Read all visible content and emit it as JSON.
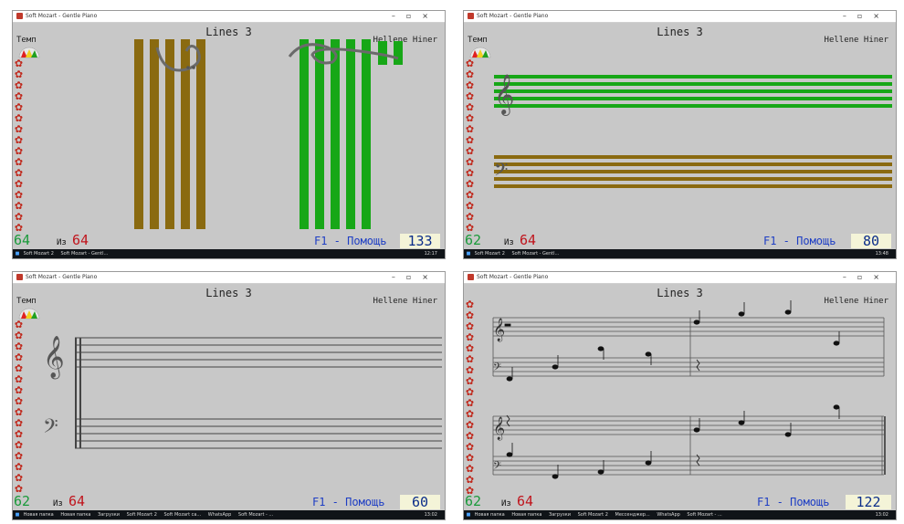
{
  "colors": {
    "accent_green": "#17a717",
    "staff_brown": "#8a6a10",
    "level_green": "#1a9a3a",
    "total_red": "#c0141c",
    "help_blue": "#1e3ec4",
    "rose_red": "#c0281c"
  },
  "icons": {
    "tempo": "tempo-gauge-icon",
    "rose": "rose-icon",
    "app": "soft-mozart-app-icon"
  },
  "panels": [
    {
      "window_title": "Soft Mozart - Gentle Piano",
      "title": "Lines 3",
      "author": "Hellene Hiner",
      "tempo_label": "Темп",
      "level": "64",
      "of_label": "Из",
      "of_total": "64",
      "help": "F1 - Помощь",
      "score": "133",
      "taskbar_items": [
        "Soft Mozart 2",
        "Soft Mozart - Gentl..."
      ],
      "clock": "12:17"
    },
    {
      "window_title": "Soft Mozart - Gentle Piano",
      "title": "Lines 3",
      "author": "Hellene Hiner",
      "tempo_label": "Темп",
      "level": "62",
      "of_label": "Из",
      "of_total": "64",
      "help": "F1 - Помощь",
      "score": "80",
      "taskbar_items": [
        "Soft Mozart 2",
        "Soft Mozart - Gentl..."
      ],
      "clock": "13:48"
    },
    {
      "window_title": "Soft Mozart - Gentle Piano",
      "title": "Lines 3",
      "author": "Hellene Hiner",
      "tempo_label": "Темп",
      "level": "62",
      "of_label": "Из",
      "of_total": "64",
      "help": "F1 - Помощь",
      "score": "60",
      "taskbar_items": [
        "Новая папка",
        "Новая папка",
        "Загрузки",
        "Soft Mozart 2",
        "Soft Mozart ca...",
        "WhatsApp",
        "Soft Mozart - ..."
      ],
      "clock": "13:02"
    },
    {
      "window_title": "Soft Mozart - Gentle Piano",
      "title": "Lines 3",
      "author": "Hellene Hiner",
      "tempo_label": "",
      "level": "62",
      "of_label": "Из",
      "of_total": "64",
      "help": "F1 - Помощь",
      "score": "122",
      "taskbar_items": [
        "Новая папка",
        "Новая папка",
        "Загрузки",
        "Soft Mozart 2",
        "Мессенджер...",
        "WhatsApp",
        "Soft Mozart - ..."
      ],
      "clock": "13:02"
    }
  ]
}
